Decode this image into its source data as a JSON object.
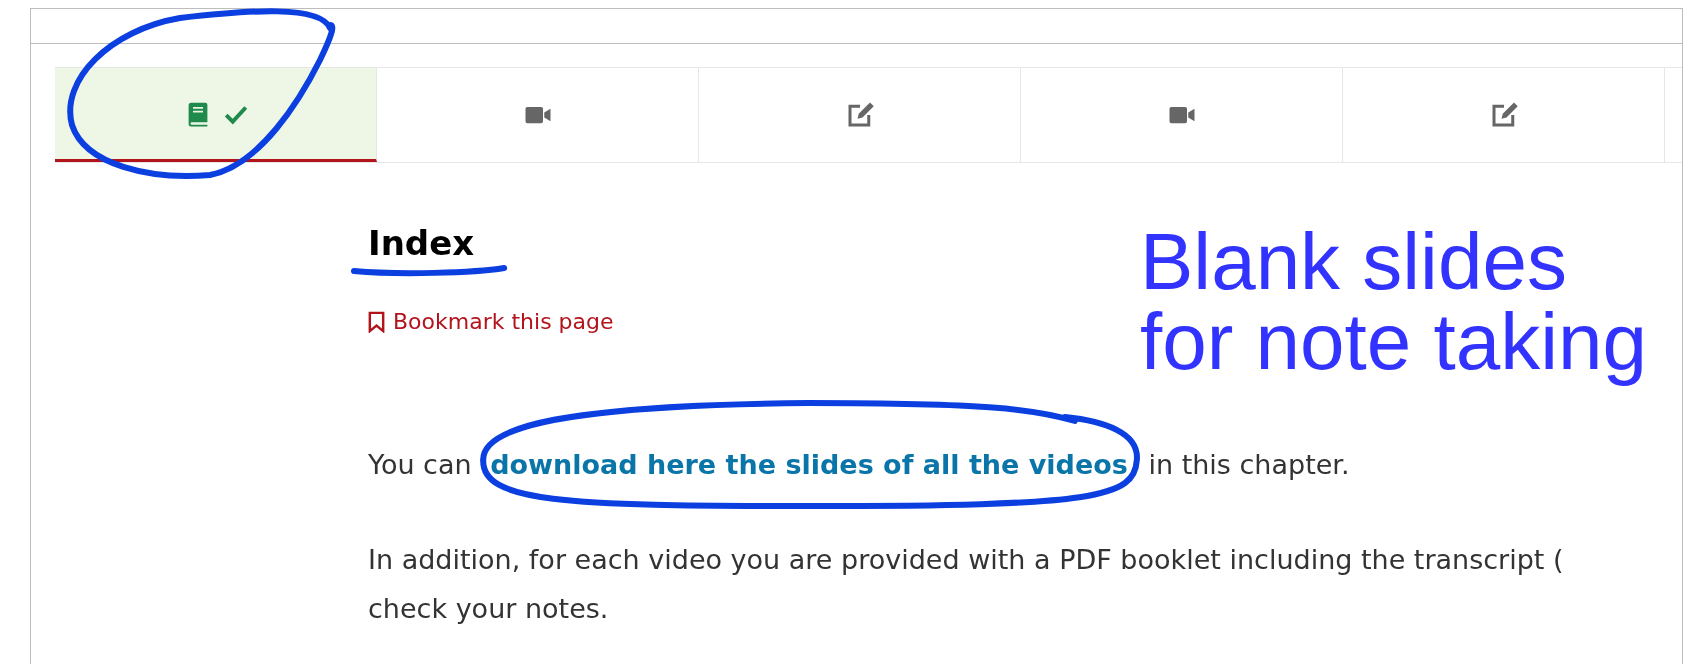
{
  "tabs": [
    {
      "kind": "reading",
      "selected": true,
      "completed": true
    },
    {
      "kind": "video",
      "selected": false,
      "completed": false
    },
    {
      "kind": "problem",
      "selected": false,
      "completed": false
    },
    {
      "kind": "video",
      "selected": false,
      "completed": false
    },
    {
      "kind": "problem",
      "selected": false,
      "completed": false
    }
  ],
  "content": {
    "heading": "Index",
    "bookmark": "Bookmark this page",
    "paragraphs": [
      {
        "before": "You can ",
        "link": "download here the slides of all the videos",
        "after": " in this chapter."
      },
      {
        "before": "In addition, for each video you are provided with a PDF booklet including the transcript ("
      }
    ],
    "last_line": "check your notes."
  },
  "annotation": {
    "note": "Blank slides for note taking"
  }
}
